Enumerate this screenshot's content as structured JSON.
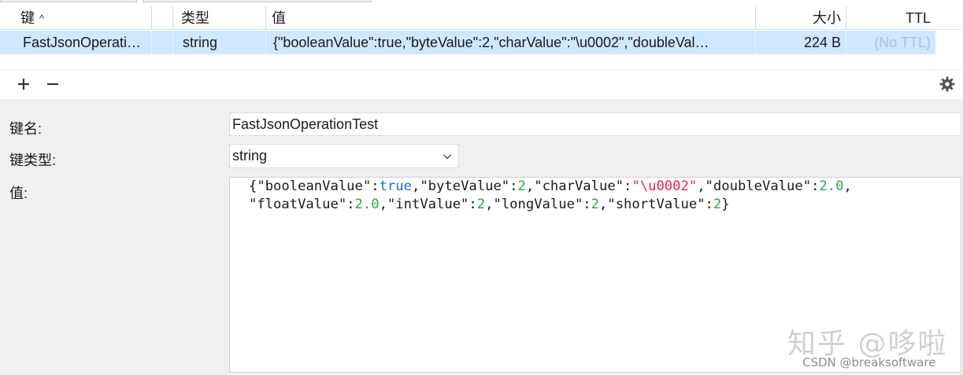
{
  "table": {
    "headers": {
      "key": "键",
      "type": "类型",
      "value": "值",
      "size": "大小",
      "ttl": "TTL"
    },
    "row": {
      "key": "FastJsonOperati…",
      "type": "string",
      "value": "{\"booleanValue\":true,\"byteValue\":2,\"charValue\":\"\\u0002\",\"doubleVal…",
      "size": "224 B",
      "ttl": "(No TTL)"
    }
  },
  "toolbar": {
    "add_icon": "plus-icon",
    "remove_icon": "minus-icon",
    "settings_icon": "gear-icon"
  },
  "form": {
    "key_name_label": "键名:",
    "key_name_value": "FastJsonOperationTest",
    "key_type_label": "键类型:",
    "key_type_value": "string",
    "value_label": "值:",
    "value_tokens": {
      "open_brace": "{",
      "q_boolean": "\"booleanValue\":",
      "v_true": "true",
      "q_byte": ",\"byteValue\":",
      "v_byte": "2",
      "q_char": ",\"charValue\":",
      "v_char": "\"\\u0002\"",
      "q_double": ",\"doubleValue\":",
      "v_double": "2.0",
      "comma_end": ",",
      "q_float": "\"floatValue\":",
      "v_float": "2.0",
      "q_int": ",\"intValue\":",
      "v_int": "2",
      "q_long": ",\"longValue\":",
      "v_long": "2",
      "q_short": ",\"shortValue\":",
      "v_short": "2",
      "close_brace": "}"
    }
  },
  "watermark": {
    "zhihu": "知乎 @哆啦",
    "csdn": "CSDN @breaksoftware"
  },
  "colors": {
    "selected_row": "#cde8ff",
    "panel_bg": "#f0f0f0",
    "bool": "#1f6fd1",
    "number": "#23a94a",
    "string": "#e0274c"
  }
}
